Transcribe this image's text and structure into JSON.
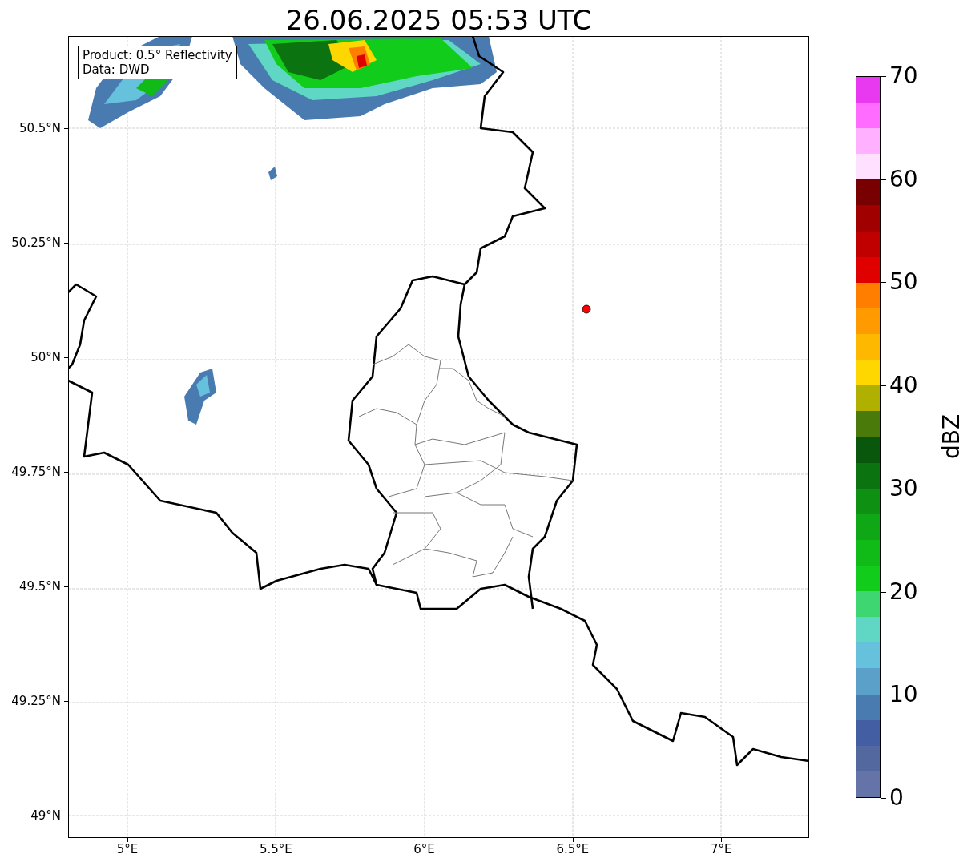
{
  "title": "26.06.2025 05:53 UTC",
  "info_box": {
    "lines": [
      "Product: 0.5° Reflectivity",
      "Data: DWD"
    ]
  },
  "y_ticks": [
    "50.5°N",
    "50.25°N",
    "50°N",
    "49.75°N",
    "49.5°N",
    "49.25°N",
    "49°N"
  ],
  "x_ticks": [
    "5°E",
    "5.5°E",
    "6°E",
    "6.5°E",
    "7°E"
  ],
  "colorbar": {
    "label": "dBZ",
    "ticks": [
      "70",
      "60",
      "50",
      "40",
      "30",
      "20",
      "10",
      "0"
    ],
    "segments": [
      {
        "color": "#6474a8"
      },
      {
        "color": "#5468a0"
      },
      {
        "color": "#435ea3"
      },
      {
        "color": "#4a7bb0"
      },
      {
        "color": "#5ba0c8"
      },
      {
        "color": "#66c2dc"
      },
      {
        "color": "#60d6c4"
      },
      {
        "color": "#3dd670"
      },
      {
        "color": "#11cc1a"
      },
      {
        "color": "#10bb18"
      },
      {
        "color": "#0fa715"
      },
      {
        "color": "#0e9013"
      },
      {
        "color": "#0b7410"
      },
      {
        "color": "#08570c"
      },
      {
        "color": "#4a7a0a"
      },
      {
        "color": "#b0b000"
      },
      {
        "color": "#ffd700"
      },
      {
        "color": "#ffb800"
      },
      {
        "color": "#ff9a00"
      },
      {
        "color": "#ff7e00"
      },
      {
        "color": "#e00000"
      },
      {
        "color": "#c00000"
      },
      {
        "color": "#a00000"
      },
      {
        "color": "#780000"
      },
      {
        "color": "#ffe0ff"
      },
      {
        "color": "#ffb0ff"
      },
      {
        "color": "#ff6cff"
      },
      {
        "color": "#e838f0"
      }
    ]
  }
}
